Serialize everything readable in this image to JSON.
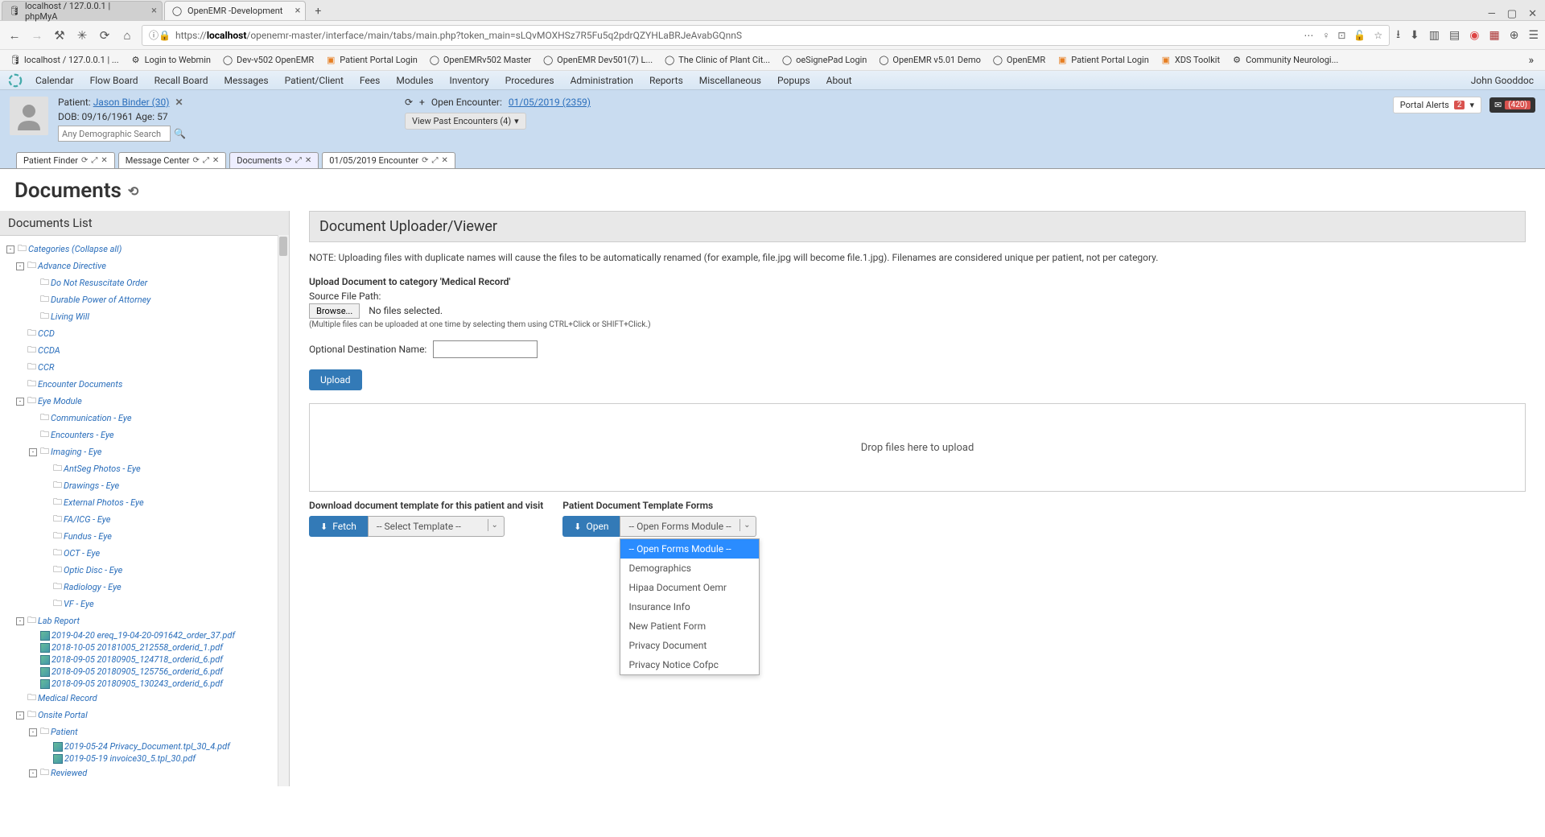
{
  "browser": {
    "tabs": [
      {
        "title": "localhost / 127.0.0.1 | phpMyA",
        "favicon": "pma"
      },
      {
        "title": "OpenEMR -Development",
        "favicon": "oemr",
        "active": true
      }
    ],
    "url_prefix": "https://",
    "url_host": "localhost",
    "url_path": "/openemr-master/interface/main/tabs/main.php?token_main=sLQvMOXHSz7R5Fu5q2pdrQZYHLaBRJeAvabGQnnS",
    "bookmarks": [
      {
        "label": "localhost / 127.0.0.1 | ...",
        "icon": "pma"
      },
      {
        "label": "Login to Webmin",
        "icon": "gear"
      },
      {
        "label": "Dev-v502 OpenEMR",
        "icon": "oemr"
      },
      {
        "label": "Patient Portal Login",
        "icon": "portal"
      },
      {
        "label": "OpenEMRv502 Master",
        "icon": "oemr"
      },
      {
        "label": "OpenEMR Dev501(7) L...",
        "icon": "oemr"
      },
      {
        "label": "The Clinic of Plant Cit...",
        "icon": "oemr"
      },
      {
        "label": "oeSignePad Login",
        "icon": "oemr"
      },
      {
        "label": "OpenEMR v5.01 Demo",
        "icon": "oemr"
      },
      {
        "label": "OpenEMR",
        "icon": "oemr"
      },
      {
        "label": "Patient Portal Login",
        "icon": "portal"
      },
      {
        "label": "XDS Toolkit",
        "icon": "xds"
      },
      {
        "label": "Community Neurologi...",
        "icon": "gear"
      }
    ]
  },
  "app_menu": [
    "Calendar",
    "Flow Board",
    "Recall Board",
    "Messages",
    "Patient/Client",
    "Fees",
    "Modules",
    "Inventory",
    "Procedures",
    "Administration",
    "Reports",
    "Miscellaneous",
    "Popups",
    "About"
  ],
  "app_user": "John Gooddoc",
  "patient": {
    "label": "Patient:",
    "name": "Jason Binder (30)",
    "dob_label": "DOB: 09/16/1961 Age: 57",
    "search_placeholder": "Any Demographic Search"
  },
  "encounter": {
    "open_label": "Open Encounter:",
    "open_value": "01/05/2019 (2359)",
    "past_label": "View Past Encounters  (4)"
  },
  "alerts": {
    "portal_label": "Portal Alerts",
    "portal_count": "2",
    "mail_count": "(420)"
  },
  "inner_tabs": [
    {
      "label": "Patient Finder"
    },
    {
      "label": "Message Center"
    },
    {
      "label": "Documents",
      "active": true
    },
    {
      "label": "01/05/2019 Encounter"
    }
  ],
  "page_title": "Documents",
  "left": {
    "header": "Documents List",
    "root_label": "Categories (Collapse all)",
    "tree": [
      {
        "lvl": 1,
        "toggle": "-",
        "icon": "folder",
        "text": "Advance Directive"
      },
      {
        "lvl": 2,
        "toggle": "",
        "icon": "folder",
        "text": "Do Not Resuscitate Order"
      },
      {
        "lvl": 2,
        "toggle": "",
        "icon": "folder",
        "text": "Durable Power of Attorney"
      },
      {
        "lvl": 2,
        "toggle": "",
        "icon": "folder",
        "text": "Living Will"
      },
      {
        "lvl": 1,
        "toggle": "",
        "icon": "folder",
        "text": "CCD"
      },
      {
        "lvl": 1,
        "toggle": "",
        "icon": "folder",
        "text": "CCDA"
      },
      {
        "lvl": 1,
        "toggle": "",
        "icon": "folder",
        "text": "CCR"
      },
      {
        "lvl": 1,
        "toggle": "",
        "icon": "folder",
        "text": "Encounter Documents"
      },
      {
        "lvl": 1,
        "toggle": "-",
        "icon": "folder",
        "text": "Eye Module"
      },
      {
        "lvl": 2,
        "toggle": "",
        "icon": "folder",
        "text": "Communication - Eye"
      },
      {
        "lvl": 2,
        "toggle": "",
        "icon": "folder",
        "text": "Encounters - Eye"
      },
      {
        "lvl": 2,
        "toggle": "-",
        "icon": "folder",
        "text": "Imaging - Eye"
      },
      {
        "lvl": 3,
        "toggle": "",
        "icon": "folder",
        "text": "AntSeg Photos - Eye"
      },
      {
        "lvl": 3,
        "toggle": "",
        "icon": "folder",
        "text": "Drawings - Eye"
      },
      {
        "lvl": 3,
        "toggle": "",
        "icon": "folder",
        "text": "External Photos - Eye"
      },
      {
        "lvl": 3,
        "toggle": "",
        "icon": "folder",
        "text": "FA/ICG - Eye"
      },
      {
        "lvl": 3,
        "toggle": "",
        "icon": "folder",
        "text": "Fundus - Eye"
      },
      {
        "lvl": 3,
        "toggle": "",
        "icon": "folder",
        "text": "OCT - Eye"
      },
      {
        "lvl": 3,
        "toggle": "",
        "icon": "folder",
        "text": "Optic Disc - Eye"
      },
      {
        "lvl": 3,
        "toggle": "",
        "icon": "folder",
        "text": "Radiology - Eye"
      },
      {
        "lvl": 3,
        "toggle": "",
        "icon": "folder",
        "text": "VF - Eye"
      },
      {
        "lvl": 1,
        "toggle": "-",
        "icon": "folder",
        "text": "Lab Report"
      },
      {
        "lvl": 2,
        "toggle": "",
        "icon": "doc",
        "text": "2019-04-20 ereq_19-04-20-091642_order_37.pdf"
      },
      {
        "lvl": 2,
        "toggle": "",
        "icon": "doc",
        "text": "2018-10-05 20181005_212558_orderid_1.pdf"
      },
      {
        "lvl": 2,
        "toggle": "",
        "icon": "doc",
        "text": "2018-09-05 20180905_124718_orderid_6.pdf"
      },
      {
        "lvl": 2,
        "toggle": "",
        "icon": "doc",
        "text": "2018-09-05 20180905_125756_orderid_6.pdf"
      },
      {
        "lvl": 2,
        "toggle": "",
        "icon": "doc",
        "text": "2018-09-05 20180905_130243_orderid_6.pdf"
      },
      {
        "lvl": 1,
        "toggle": "",
        "icon": "folder",
        "text": "Medical Record"
      },
      {
        "lvl": 1,
        "toggle": "-",
        "icon": "folder",
        "text": "Onsite Portal"
      },
      {
        "lvl": 2,
        "toggle": "-",
        "icon": "folder",
        "text": "Patient"
      },
      {
        "lvl": 3,
        "toggle": "",
        "icon": "doc",
        "text": "2019-05-24 Privacy_Document.tpl_30_4.pdf"
      },
      {
        "lvl": 3,
        "toggle": "",
        "icon": "doc",
        "text": "2019-05-19 invoice30_5.tpl_30.pdf"
      },
      {
        "lvl": 2,
        "toggle": "-",
        "icon": "folder",
        "text": "Reviewed"
      }
    ]
  },
  "right": {
    "header": "Document Uploader/Viewer",
    "note": "NOTE: Uploading files with duplicate names will cause the files to be automatically renamed (for example, file.jpg will become file.1.jpg). Filenames are considered unique per patient, not per category.",
    "upload_heading": "Upload Document to category 'Medical Record'",
    "source_label": "Source File Path:",
    "browse_label": "Browse...",
    "no_files": "No files selected.",
    "multi_hint": "(Multiple files can be uploaded at one time by selecting them using CTRL+Click or SHIFT+Click.)",
    "dest_label": "Optional Destination Name:",
    "upload_btn": "Upload",
    "dropzone": "Drop files here to upload",
    "template_download_label": "Download document template for this patient and visit",
    "fetch_btn": "Fetch",
    "select_template_placeholder": "-- Select Template --",
    "patient_forms_label": "Patient Document Template Forms",
    "open_btn": "Open",
    "open_forms_placeholder": "-- Open Forms Module --",
    "dropdown_options": [
      "-- Open Forms Module --",
      "Demographics",
      "Hipaa Document Oemr",
      "Insurance Info",
      "New Patient Form",
      "Privacy Document",
      "Privacy Notice Cofpc"
    ]
  }
}
